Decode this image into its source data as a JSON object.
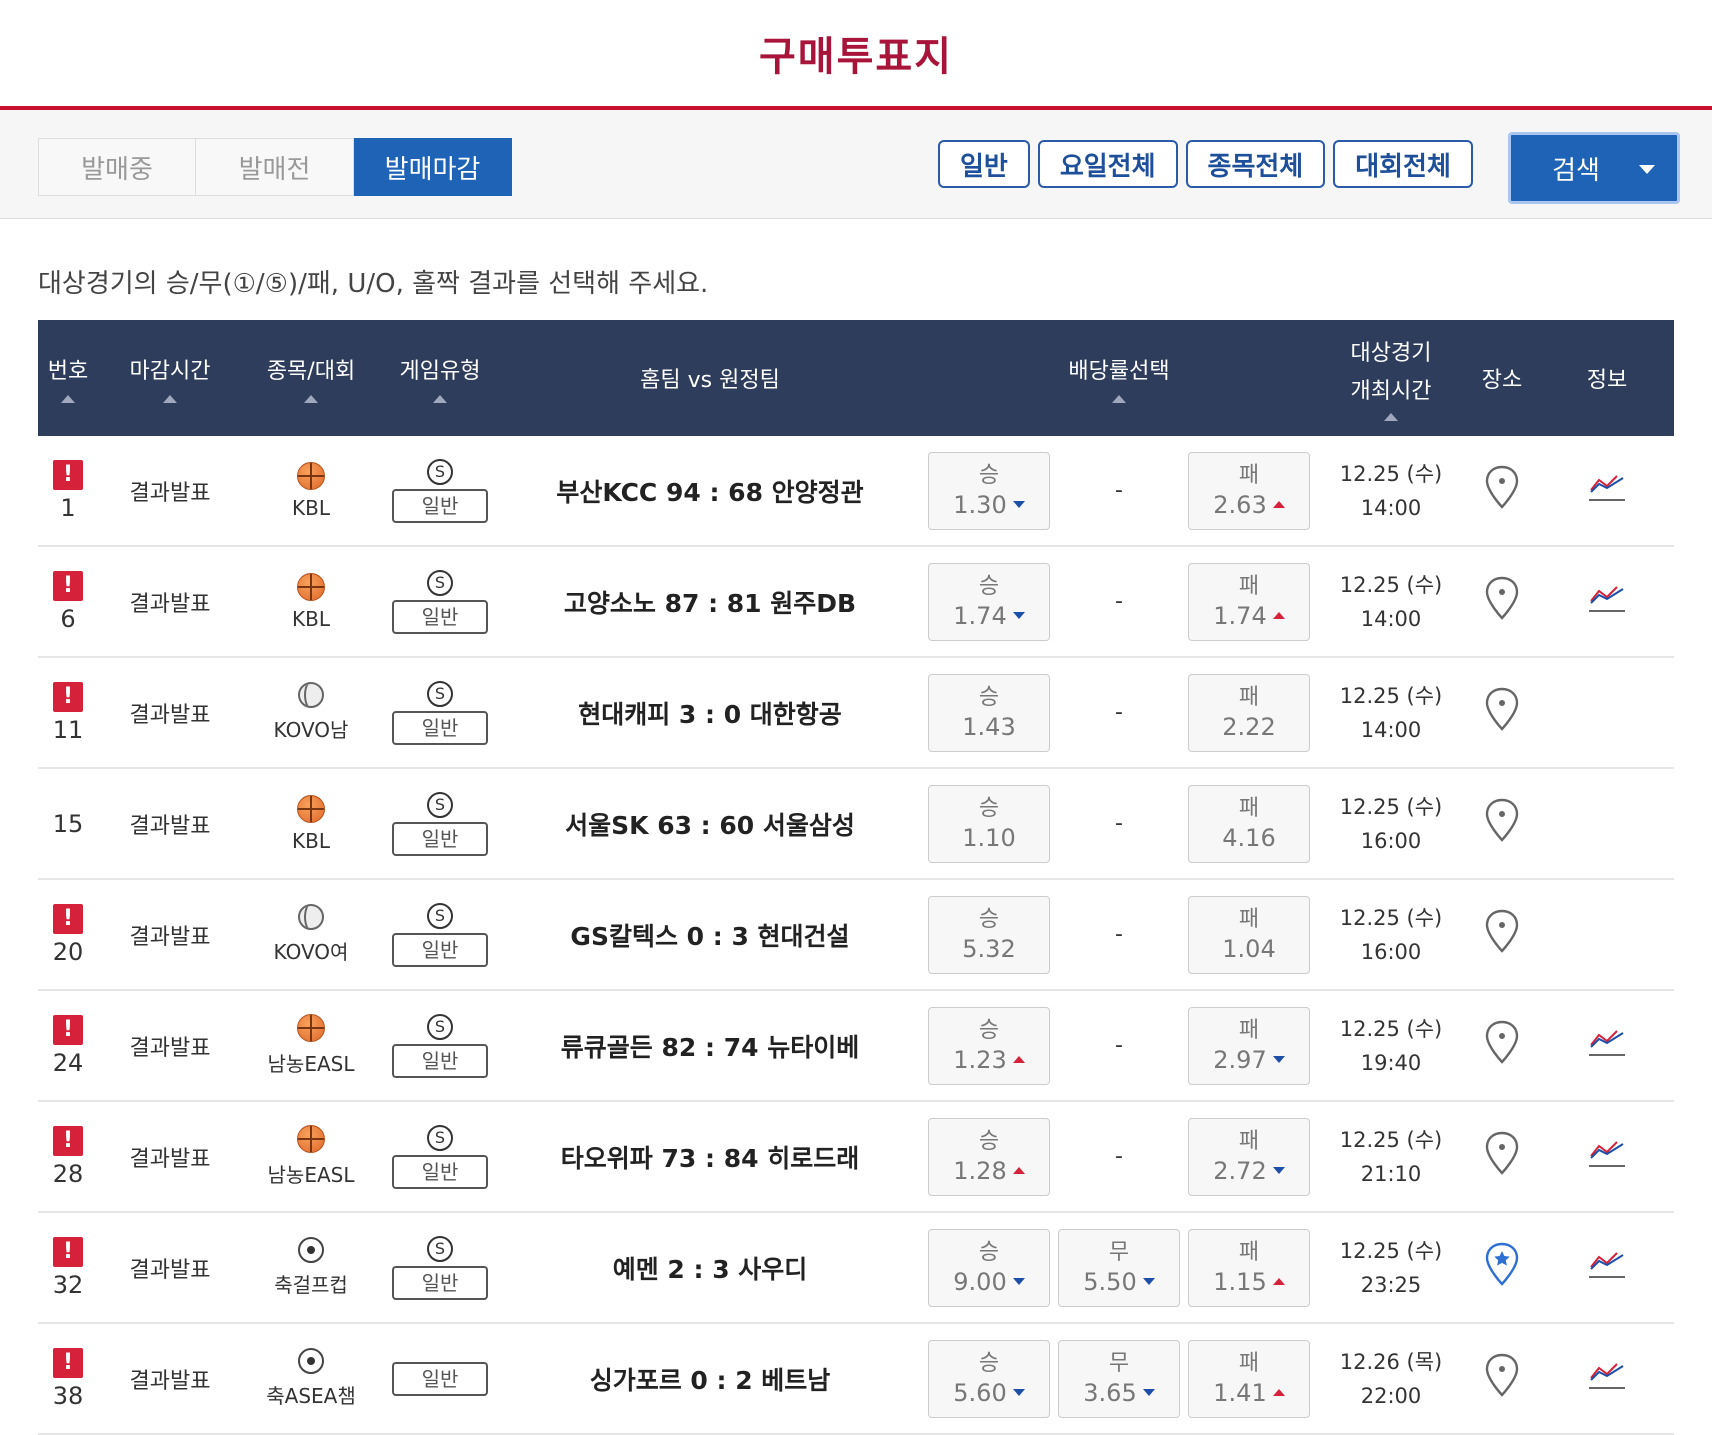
{
  "page_title": "구매투표지",
  "tabs": [
    {
      "label": "발매중",
      "active": false
    },
    {
      "label": "발매전",
      "active": false
    },
    {
      "label": "발매마감",
      "active": true
    }
  ],
  "filters": [
    "일반",
    "요일전체",
    "종목전체",
    "대회전체"
  ],
  "search_label": "검색",
  "instruction": "대상경기의 승/무(①/⑤)/패, U/O, 홀짝 결과를 선택해 주세요.",
  "columns": {
    "no": "번호",
    "deadline": "마감시간",
    "sport": "종목/대회",
    "game_type": "게임유형",
    "teams": "홈팀 vs 원정팀",
    "odds": "배당률선택",
    "start_time_1": "대상경기",
    "start_time_2": "개최시간",
    "venue": "장소",
    "info": "정보"
  },
  "colors": {
    "accent": "#1e63b5",
    "header_bg": "#2f3d5c",
    "title": "#a8143a",
    "alert": "#d6213a",
    "down": "#1e4fa8",
    "up": "#d6213a"
  },
  "rows": [
    {
      "no": "1",
      "alert": true,
      "status": "결과발표",
      "sport_icon": "basketball-icon",
      "league": "KBL",
      "s_mark": "S",
      "type": "일반",
      "match": "부산KCC 94 : 68 안양정관",
      "win": {
        "label": "승",
        "value": "1.30",
        "trend": "down"
      },
      "draw": {
        "label": "-",
        "value": "",
        "trend": ""
      },
      "lose": {
        "label": "패",
        "value": "2.63",
        "trend": "up"
      },
      "date": "12.25 (수)",
      "time": "14:00",
      "venue": "pin-icon",
      "has_chart": true
    },
    {
      "no": "6",
      "alert": true,
      "status": "결과발표",
      "sport_icon": "basketball-icon",
      "league": "KBL",
      "s_mark": "S",
      "type": "일반",
      "match": "고양소노 87 : 81 원주DB",
      "win": {
        "label": "승",
        "value": "1.74",
        "trend": "down"
      },
      "draw": {
        "label": "-",
        "value": "",
        "trend": ""
      },
      "lose": {
        "label": "패",
        "value": "1.74",
        "trend": "up"
      },
      "date": "12.25 (수)",
      "time": "14:00",
      "venue": "pin-icon",
      "has_chart": true
    },
    {
      "no": "11",
      "alert": true,
      "status": "결과발표",
      "sport_icon": "volleyball-icon",
      "league": "KOVO남",
      "s_mark": "S",
      "type": "일반",
      "match": "현대캐피 3 : 0 대한항공",
      "win": {
        "label": "승",
        "value": "1.43",
        "trend": ""
      },
      "draw": {
        "label": "-",
        "value": "",
        "trend": ""
      },
      "lose": {
        "label": "패",
        "value": "2.22",
        "trend": ""
      },
      "date": "12.25 (수)",
      "time": "14:00",
      "venue": "pin-icon",
      "has_chart": false
    },
    {
      "no": "15",
      "alert": false,
      "status": "결과발표",
      "sport_icon": "basketball-icon",
      "league": "KBL",
      "s_mark": "S",
      "type": "일반",
      "match": "서울SK 63 : 60 서울삼성",
      "win": {
        "label": "승",
        "value": "1.10",
        "trend": ""
      },
      "draw": {
        "label": "-",
        "value": "",
        "trend": ""
      },
      "lose": {
        "label": "패",
        "value": "4.16",
        "trend": ""
      },
      "date": "12.25 (수)",
      "time": "16:00",
      "venue": "pin-icon",
      "has_chart": false
    },
    {
      "no": "20",
      "alert": true,
      "status": "결과발표",
      "sport_icon": "volleyball-icon",
      "league": "KOVO여",
      "s_mark": "S",
      "type": "일반",
      "match": "GS칼텍스 0 : 3 현대건설",
      "win": {
        "label": "승",
        "value": "5.32",
        "trend": ""
      },
      "draw": {
        "label": "-",
        "value": "",
        "trend": ""
      },
      "lose": {
        "label": "패",
        "value": "1.04",
        "trend": ""
      },
      "date": "12.25 (수)",
      "time": "16:00",
      "venue": "pin-icon",
      "has_chart": false
    },
    {
      "no": "24",
      "alert": true,
      "status": "결과발표",
      "sport_icon": "basketball-icon",
      "league": "남농EASL",
      "s_mark": "S",
      "type": "일반",
      "match": "류큐골든 82 : 74 뉴타이베",
      "win": {
        "label": "승",
        "value": "1.23",
        "trend": "up"
      },
      "draw": {
        "label": "-",
        "value": "",
        "trend": ""
      },
      "lose": {
        "label": "패",
        "value": "2.97",
        "trend": "down"
      },
      "date": "12.25 (수)",
      "time": "19:40",
      "venue": "pin-icon",
      "has_chart": true
    },
    {
      "no": "28",
      "alert": true,
      "status": "결과발표",
      "sport_icon": "basketball-icon",
      "league": "남농EASL",
      "s_mark": "S",
      "type": "일반",
      "match": "타오위파 73 : 84 히로드래",
      "win": {
        "label": "승",
        "value": "1.28",
        "trend": "up"
      },
      "draw": {
        "label": "-",
        "value": "",
        "trend": ""
      },
      "lose": {
        "label": "패",
        "value": "2.72",
        "trend": "down"
      },
      "date": "12.25 (수)",
      "time": "21:10",
      "venue": "pin-icon",
      "has_chart": true
    },
    {
      "no": "32",
      "alert": true,
      "status": "결과발표",
      "sport_icon": "soccer-ball-icon",
      "league": "축걸프컵",
      "s_mark": "S",
      "type": "일반",
      "match": "예멘 2 : 3 사우디",
      "win": {
        "label": "승",
        "value": "9.00",
        "trend": "down"
      },
      "draw": {
        "label": "무",
        "value": "5.50",
        "trend": "down"
      },
      "lose": {
        "label": "패",
        "value": "1.15",
        "trend": "up"
      },
      "date": "12.25 (수)",
      "time": "23:25",
      "venue": "pin-star-icon",
      "has_chart": true
    },
    {
      "no": "38",
      "alert": true,
      "status": "결과발표",
      "sport_icon": "soccer-ball-icon",
      "league": "축ASEA챔",
      "s_mark": "",
      "type": "일반",
      "match": "싱가포르 0 : 2 베트남",
      "win": {
        "label": "승",
        "value": "5.60",
        "trend": "down"
      },
      "draw": {
        "label": "무",
        "value": "3.65",
        "trend": "down"
      },
      "lose": {
        "label": "패",
        "value": "1.41",
        "trend": "up"
      },
      "date": "12.26 (목)",
      "time": "22:00",
      "venue": "pin-icon",
      "has_chart": true
    }
  ]
}
